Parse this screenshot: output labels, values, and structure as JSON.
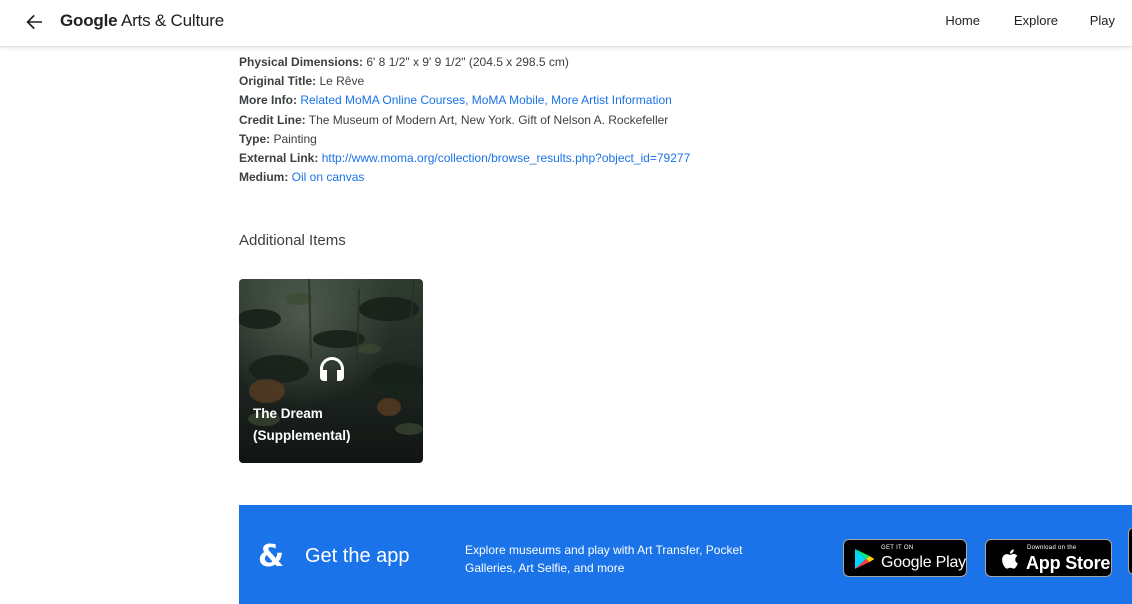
{
  "header": {
    "logo_brand": "Google",
    "logo_rest": " Arts & Culture",
    "nav": {
      "home": "Home",
      "explore": "Explore",
      "play": "Play"
    }
  },
  "details": {
    "physical_dimensions_label": "Physical Dimensions:",
    "physical_dimensions_value": " 6' 8 1/2\" x 9' 9 1/2\" (204.5 x 298.5 cm)",
    "original_title_label": "Original Title:",
    "original_title_value": " Le Rêve",
    "more_info_label": "More Info:",
    "more_info_link": " Related MoMA Online Courses, MoMA Mobile, More Artist Information",
    "credit_line_label": "Credit Line:",
    "credit_line_value": " The Museum of Modern Art, New York. Gift of Nelson A. Rockefeller",
    "type_label": "Type:",
    "type_value": " Painting",
    "external_link_label": "External Link:",
    "external_link_value": " http://www.moma.org/collection/browse_results.php?object_id=79277",
    "medium_label": "Medium:",
    "medium_value": " Oil on canvas"
  },
  "additional": {
    "title": "Additional Items",
    "items": [
      {
        "title": "The Dream (Supplemental)",
        "icon": "headphones-icon"
      }
    ]
  },
  "banner": {
    "get_app": "Get the app",
    "description": "Explore museums and play with Art Transfer, Pocket Galleries, Art Selfie, and more",
    "google_play_small": "GET IT ON",
    "google_play_big": "Google Play",
    "app_store_small": "Download on the",
    "app_store_big": "App Store"
  },
  "colors": {
    "link": "#1a73e8",
    "banner": "#1a73e8",
    "text": "#3c4043"
  }
}
